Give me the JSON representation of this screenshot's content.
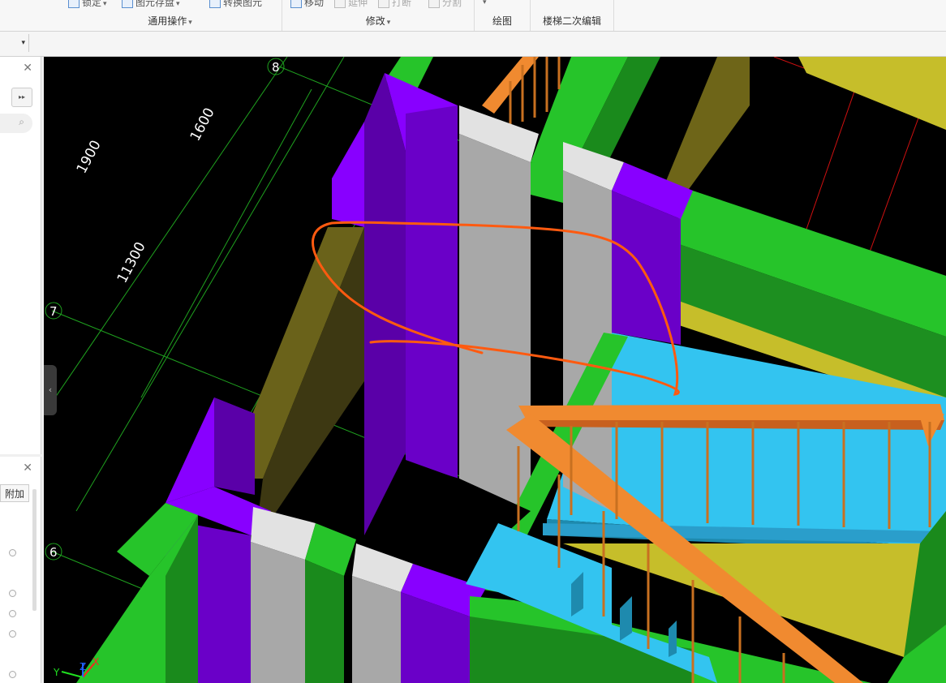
{
  "ribbon": {
    "groups": [
      {
        "title": "通用操作",
        "buttons": [
          "锁定",
          "图元存盘",
          "转换图元"
        ]
      },
      {
        "title": "修改",
        "buttons": [
          "移动",
          "延伸",
          "打断",
          "分割"
        ]
      },
      {
        "title": "绘图"
      },
      {
        "title": "楼梯二次编辑"
      }
    ]
  },
  "left_panel": {
    "attach_tab": "附加"
  },
  "viewport": {
    "dimensions": [
      "1900",
      "1600",
      "11300"
    ],
    "axis_labels": [
      "8",
      "7",
      "6"
    ],
    "coord_axes": [
      "Y",
      "Z",
      "X"
    ]
  },
  "colors": {
    "wall_purple": "#6a00c8",
    "wall_purple_top": "#8800ff",
    "beam_green": "#26c42a",
    "column_gray": "#a8a8a8",
    "stair_cyan": "#33c4f0",
    "railing_orange": "#f08a30",
    "slab_olive": "#c6be2a",
    "annotation_red": "#ff5a10",
    "grid_green": "#1fa21f"
  }
}
